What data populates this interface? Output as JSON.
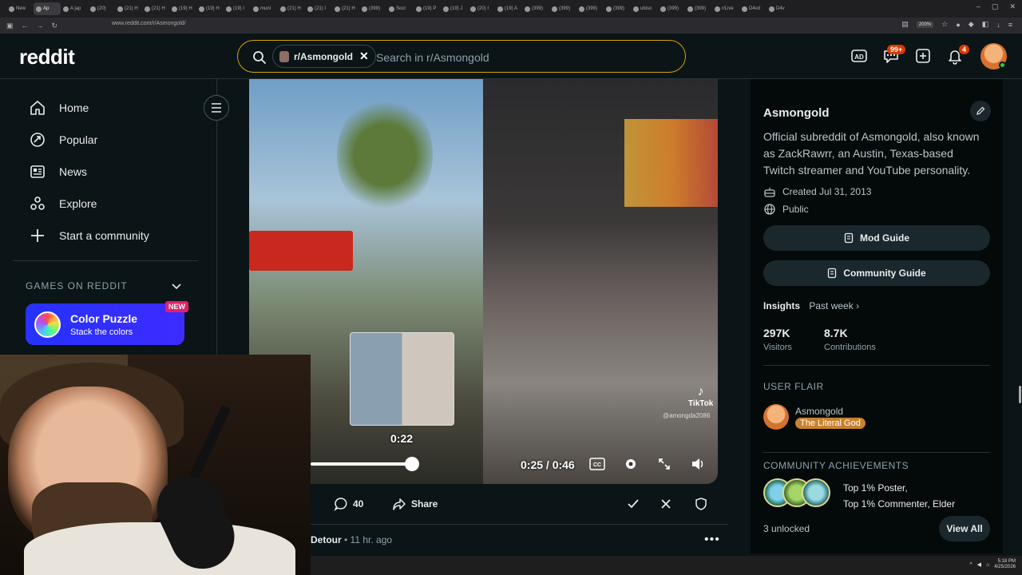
{
  "browser": {
    "tabs": [
      {
        "label": "New"
      },
      {
        "label": "Ap"
      },
      {
        "label": "A jap"
      },
      {
        "label": "(20)"
      },
      {
        "label": "(21) H"
      },
      {
        "label": "(21) H"
      },
      {
        "label": "(19) H"
      },
      {
        "label": "(19) H"
      },
      {
        "label": "(19) I"
      },
      {
        "label": "muni"
      },
      {
        "label": "(21) H"
      },
      {
        "label": "(21) I"
      },
      {
        "label": "(21) H"
      },
      {
        "label": "(399)"
      },
      {
        "label": "Socr"
      },
      {
        "label": "(19) P"
      },
      {
        "label": "(19) J"
      },
      {
        "label": "(20) I"
      },
      {
        "label": "(19) A"
      },
      {
        "label": "(399)"
      },
      {
        "label": "(399)"
      },
      {
        "label": "(399)"
      },
      {
        "label": "(399)"
      },
      {
        "label": "ubiso"
      },
      {
        "label": "(399)"
      },
      {
        "label": "(399)"
      },
      {
        "label": "r/Live"
      },
      {
        "label": "D4vd"
      },
      {
        "label": "D4v"
      }
    ],
    "url": "www.reddit.com/r/Asmongold/",
    "zoom": "200%"
  },
  "header": {
    "logo": "reddit",
    "search": {
      "chip_label": "r/Asmongold",
      "placeholder": "Search in r/Asmongold"
    },
    "chat_badge": "99+",
    "notif_badge": "4"
  },
  "sidebar": {
    "nav": [
      {
        "label": "Home",
        "icon": "home-icon"
      },
      {
        "label": "Popular",
        "icon": "popular-icon"
      },
      {
        "label": "News",
        "icon": "news-icon"
      },
      {
        "label": "Explore",
        "icon": "explore-icon"
      },
      {
        "label": "Start a community",
        "icon": "plus-icon"
      }
    ],
    "games_heading": "GAMES ON REDDIT",
    "color_puzzle": {
      "title": "Color Puzzle",
      "subtitle": "Stack the colors",
      "badge": "NEW"
    }
  },
  "video": {
    "preview_time": "0:22",
    "current_time": "0:25 / 0:46",
    "progress_fraction": 0.54,
    "tiktok_label": "TikTok",
    "tiktok_handle": "@amongda2086"
  },
  "post": {
    "comments": "40",
    "share_label": "Share",
    "next_post_author": "Detour",
    "next_post_time": "• 11 hr. ago"
  },
  "rightbar": {
    "name": "Asmongold",
    "description": "Official subreddit of Asmongold, also known as ZackRawrr, an Austin, Texas-based Twitch streamer and YouTube personality.",
    "created": "Created Jul 31, 2013",
    "visibility": "Public",
    "mod_guide": "Mod Guide",
    "community_guide": "Community Guide",
    "insights_label": "Insights",
    "insights_period": "Past week",
    "visitors_value": "297K",
    "visitors_label": "Visitors",
    "contributions_value": "8.7K",
    "contributions_label": "Contributions",
    "user_flair_heading": "USER FLAIR",
    "flair_user": "Asmongold",
    "flair_tag": "The Literal God",
    "achievements_heading": "COMMUNITY ACHIEVEMENTS",
    "achievement_1": "Top 1% Poster,",
    "achievement_2": "Top 1% Commenter, Elder",
    "unlocked": "3 unlocked",
    "view_all": "View All"
  },
  "taskbar": {
    "time": "5:18 PM",
    "date": "4/25/2026"
  },
  "colors": {
    "accent": "#d93900",
    "search_border": "#d4a200",
    "puzzle_bg": "#2632ff"
  }
}
